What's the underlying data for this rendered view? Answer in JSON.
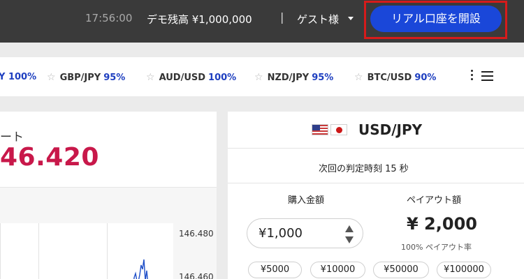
{
  "header": {
    "clock": "17:56:00",
    "balance": "デモ残高 ¥1,000,000",
    "separator": "|",
    "guest": "ゲスト様",
    "cta_label": "リアル口座を開設"
  },
  "watchlist": {
    "items": [
      {
        "pair": "",
        "pct": "Y 100%"
      },
      {
        "pair": "GBP/JPY",
        "pct": "95%"
      },
      {
        "pair": "AUD/USD",
        "pct": "100%"
      },
      {
        "pair": "NZD/JPY",
        "pct": "95%"
      },
      {
        "pair": "BTC/USD",
        "pct": "90%"
      }
    ],
    "star_glyph": "☆"
  },
  "rate_panel": {
    "label": "ート",
    "value": "46.420",
    "y_ticks": [
      "146.480",
      "146.460"
    ]
  },
  "trade": {
    "pair": "USD/JPY",
    "judge_text": "次回の判定時刻 15 秒",
    "purchase_label": "購入金額",
    "payout_label": "ペイアウト額",
    "amount_value": "¥1,000",
    "payout_value": "¥ 2,000",
    "payout_rate": "100% ペイアウト率",
    "presets": [
      "¥5000",
      "¥10000",
      "¥50000",
      "¥100000"
    ]
  },
  "colors": {
    "header_bg": "#3a3a3a",
    "cta_bg": "#1a47d9",
    "highlight_border": "#d61b1b",
    "rate_red": "#c8184a",
    "pct_blue": "#1e3fc0"
  }
}
